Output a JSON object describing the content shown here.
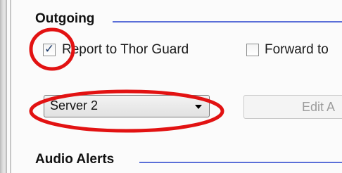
{
  "outgoing": {
    "header": "Outgoing",
    "report_checkbox": {
      "label": "Report to Thor Guard",
      "checked": true
    },
    "forward_checkbox": {
      "label": "Forward to",
      "checked": false
    },
    "server_select": {
      "value": "Server 2"
    },
    "edit_button": {
      "label": "Edit A"
    }
  },
  "audio_alerts": {
    "header": "Audio Alerts"
  },
  "colors": {
    "rule": "#5b6fd8",
    "annotation": "#e21212"
  }
}
